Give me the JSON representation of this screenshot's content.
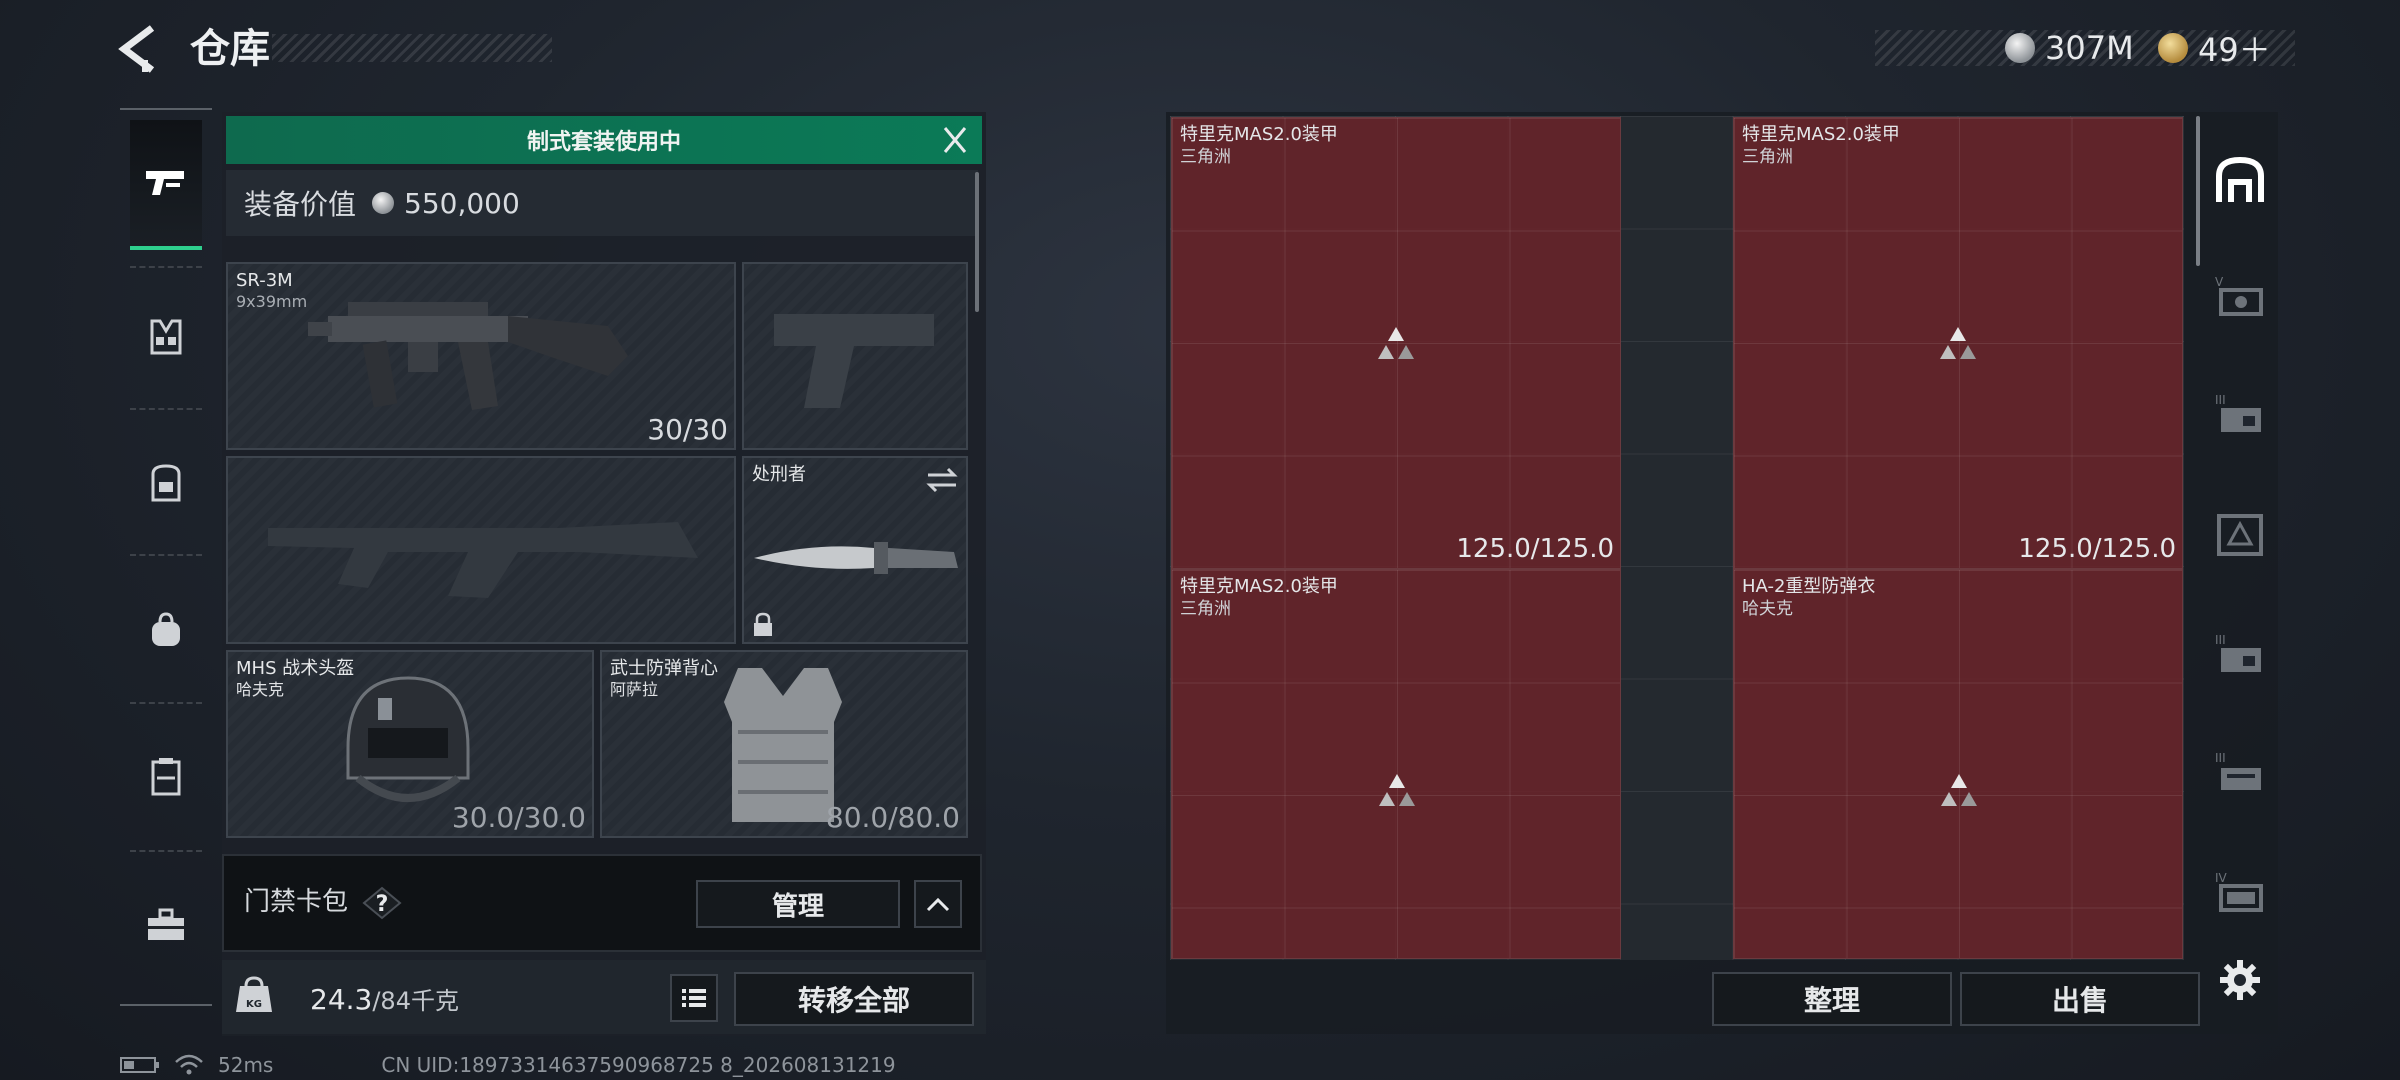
{
  "header": {
    "title": "仓库",
    "currencies": [
      {
        "name": "silver-coin",
        "amount": "307M"
      },
      {
        "name": "gold-coin",
        "amount": "49＋"
      }
    ]
  },
  "left_tabs": [
    {
      "icon": "pistol-icon",
      "active": true
    },
    {
      "icon": "vest-icon",
      "active": false
    },
    {
      "icon": "backpack-icon",
      "active": false
    },
    {
      "icon": "bag-icon",
      "active": false
    },
    {
      "icon": "case-icon",
      "active": false
    },
    {
      "icon": "toolbox-icon",
      "active": false
    }
  ],
  "loadout": {
    "banner": "制式套装使用中",
    "value_label": "装备价值",
    "value": "550,000",
    "primary": {
      "name": "SR-3M",
      "caliber": "9x39mm",
      "ammo": "30/30"
    },
    "melee": {
      "name": "处刑者"
    },
    "helmet": {
      "name": "MHS 战术头盔",
      "brand": "哈夫克",
      "durability": "30.0/30.0"
    },
    "armor": {
      "name": "武士防弹背心",
      "brand": "阿萨拉",
      "durability": "80.0/80.0"
    }
  },
  "keycard": {
    "label": "门禁卡包",
    "help": "?",
    "manage": "管理"
  },
  "weight": {
    "current": "24.3",
    "max": "/84千克"
  },
  "transfer_all": "转移全部",
  "storage": {
    "items": [
      {
        "name": "特里克MAS2.0装甲",
        "brand": "三角洲",
        "durability": "125.0/125.0"
      },
      {
        "name": "特里克MAS2.0装甲",
        "brand": "三角洲",
        "durability": "125.0/125.0"
      },
      {
        "name": "特里克MAS2.0装甲",
        "brand": "三角洲",
        "durability": ""
      },
      {
        "name": "HA-2重型防弹衣",
        "brand": "哈夫克",
        "durability": ""
      }
    ],
    "sort": "整理",
    "sell": "出售"
  },
  "right_tabs": [
    {
      "icon": "storage-home-icon",
      "active": true
    },
    {
      "icon": "storage-v-icon"
    },
    {
      "icon": "storage-iii-icon"
    },
    {
      "icon": "storage-triangle-icon"
    },
    {
      "icon": "storage-iii-b-icon"
    },
    {
      "icon": "storage-ii-icon"
    },
    {
      "icon": "storage-iv-icon"
    }
  ],
  "status": {
    "ping": "52ms",
    "uid": "CN UID:18973314637590968725 8_202608131219"
  }
}
